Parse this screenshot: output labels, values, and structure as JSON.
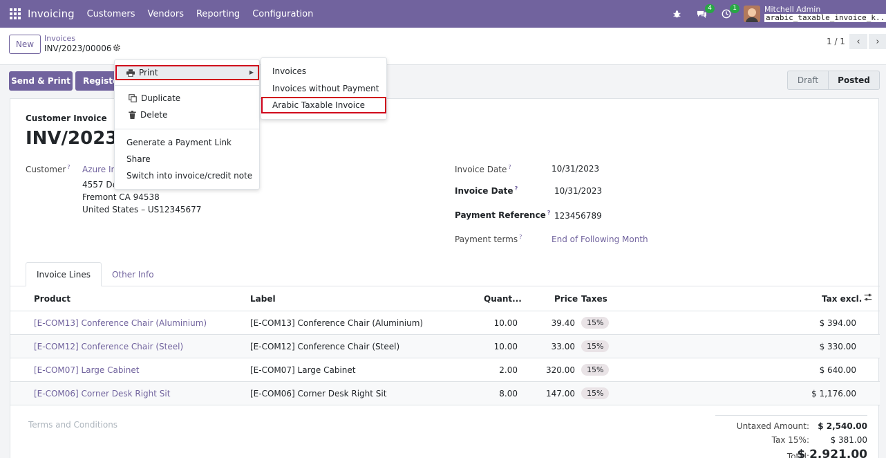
{
  "navbar": {
    "app_title": "Invoicing",
    "menu": [
      "Customers",
      "Vendors",
      "Reporting",
      "Configuration"
    ],
    "chat_badge": "4",
    "activity_badge": "1",
    "user_name": "Mitchell Admin",
    "db_name": "arabic_taxable_invoice_k..."
  },
  "control": {
    "new_label": "New",
    "breadcrumb_parent": "Invoices",
    "breadcrumb_current": "INV/2023/00006",
    "pager_value": "1 / 1"
  },
  "actions": {
    "send_print": "Send & Print",
    "register": "Registe"
  },
  "status": {
    "draft": "Draft",
    "posted": "Posted"
  },
  "menu": {
    "print": "Print",
    "duplicate": "Duplicate",
    "delete": "Delete",
    "payment_link": "Generate a Payment Link",
    "share": "Share",
    "switch": "Switch into invoice/credit note"
  },
  "submenu": {
    "items": [
      "Invoices",
      "Invoices without Payment",
      "Arabic Taxable Invoice"
    ]
  },
  "invoice": {
    "type_label": "Customer Invoice",
    "number": "INV/2023/00006",
    "customer_label": "Customer",
    "customer_name": "Azure In",
    "address_line1": "4557 De",
    "address_line2": "Fremont CA 94538",
    "address_line3": "United States – US12345677",
    "invoice_date_label": "Invoice Date",
    "invoice_date": "10/31/2023",
    "invoice_date2_label": "Invoice Date",
    "invoice_date2": "10/31/2023",
    "payment_ref_label": "Payment Reference",
    "payment_ref": "123456789",
    "payment_terms_label": "Payment terms",
    "payment_terms": "End of Following Month",
    "help_mark": "?"
  },
  "tabs": [
    "Invoice Lines",
    "Other Info"
  ],
  "table": {
    "headers": {
      "product": "Product",
      "label": "Label",
      "quantity": "Quant...",
      "price": "Price",
      "taxes": "Taxes",
      "tax_excl": "Tax excl."
    },
    "rows": [
      {
        "product": "[E-COM13] Conference Chair (Aluminium)",
        "label": "[E-COM13] Conference Chair (Aluminium)",
        "quantity": "10.00",
        "price": "39.40",
        "tax": "15%",
        "subtotal": "$ 394.00"
      },
      {
        "product": "[E-COM12] Conference Chair (Steel)",
        "label": "[E-COM12] Conference Chair (Steel)",
        "quantity": "10.00",
        "price": "33.00",
        "tax": "15%",
        "subtotal": "$ 330.00"
      },
      {
        "product": "[E-COM07] Large Cabinet",
        "label": "[E-COM07] Large Cabinet",
        "quantity": "2.00",
        "price": "320.00",
        "tax": "15%",
        "subtotal": "$ 640.00"
      },
      {
        "product": "[E-COM06] Corner Desk Right Sit",
        "label": "[E-COM06] Corner Desk Right Sit",
        "quantity": "8.00",
        "price": "147.00",
        "tax": "15%",
        "subtotal": "$ 1,176.00"
      }
    ]
  },
  "terms_placeholder": "Terms and Conditions",
  "totals": {
    "untaxed_label": "Untaxed Amount:",
    "untaxed_value": "$ 2,540.00",
    "tax_label": "Tax 15%:",
    "tax_value": "$ 381.00",
    "total_label": "Total:",
    "total_value": "$ 2,921.00"
  },
  "colors": {
    "brand": "#71639e",
    "highlight_border": "#d0021b",
    "badge": "#28a745"
  }
}
